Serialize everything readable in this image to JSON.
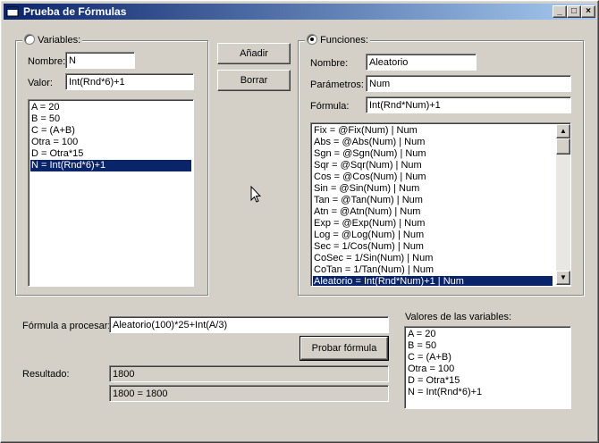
{
  "window": {
    "title": "Prueba de Fórmulas",
    "minimize": "_",
    "maximize": "□",
    "close": "×"
  },
  "variables": {
    "radio_label": "Variables:",
    "nombre_label": "Nombre:",
    "nombre_value": "N",
    "valor_label": "Valor:",
    "valor_value": "Int(Rnd*6)+1",
    "list": [
      "A = 20",
      "B = 50",
      "C = (A+B)",
      "Otra = 100",
      "D = Otra*15",
      "N = Int(Rnd*6)+1"
    ],
    "selected_index": 5
  },
  "actions": {
    "add_label": "Añadir",
    "delete_label": "Borrar"
  },
  "functions": {
    "radio_label": "Funciones:",
    "nombre_label": "Nombre:",
    "nombre_value": "Aleatorio",
    "parametros_label": "Parámetros:",
    "parametros_value": "Num",
    "formula_label": "Fórmula:",
    "formula_value": "Int(Rnd*Num)+1",
    "list": [
      "Fix = @Fix(Num) | Num",
      "Abs = @Abs(Num) | Num",
      "Sgn = @Sgn(Num) | Num",
      "Sqr = @Sqr(Num) | Num",
      "Cos = @Cos(Num) | Num",
      "Sin = @Sin(Num) | Num",
      "Tan = @Tan(Num) | Num",
      "Atn = @Atn(Num) | Num",
      "Exp = @Exp(Num) | Num",
      "Log = @Log(Num) | Num",
      "Sec = 1/Cos(Num) | Num",
      "CoSec = 1/Sin(Num) | Num",
      "CoTan = 1/Tan(Num) | Num",
      "Aleatorio = Int(Rnd*Num)+1 | Num"
    ],
    "selected_index": 13
  },
  "process": {
    "formula_label": "Fórmula a procesar:",
    "formula_value": "Aleatorio(100)*25+Int(A/3)",
    "test_button": "Probar fórmula",
    "result_label": "Resultado:",
    "result_value": "1800",
    "result_detail": "1800 = 1800"
  },
  "values_panel": {
    "label": "Valores de las variables:",
    "list": [
      "A = 20",
      "B = 50",
      "C = (A+B)",
      "Otra = 100",
      "D = Otra*15",
      "N = Int(Rnd*6)+1"
    ]
  }
}
